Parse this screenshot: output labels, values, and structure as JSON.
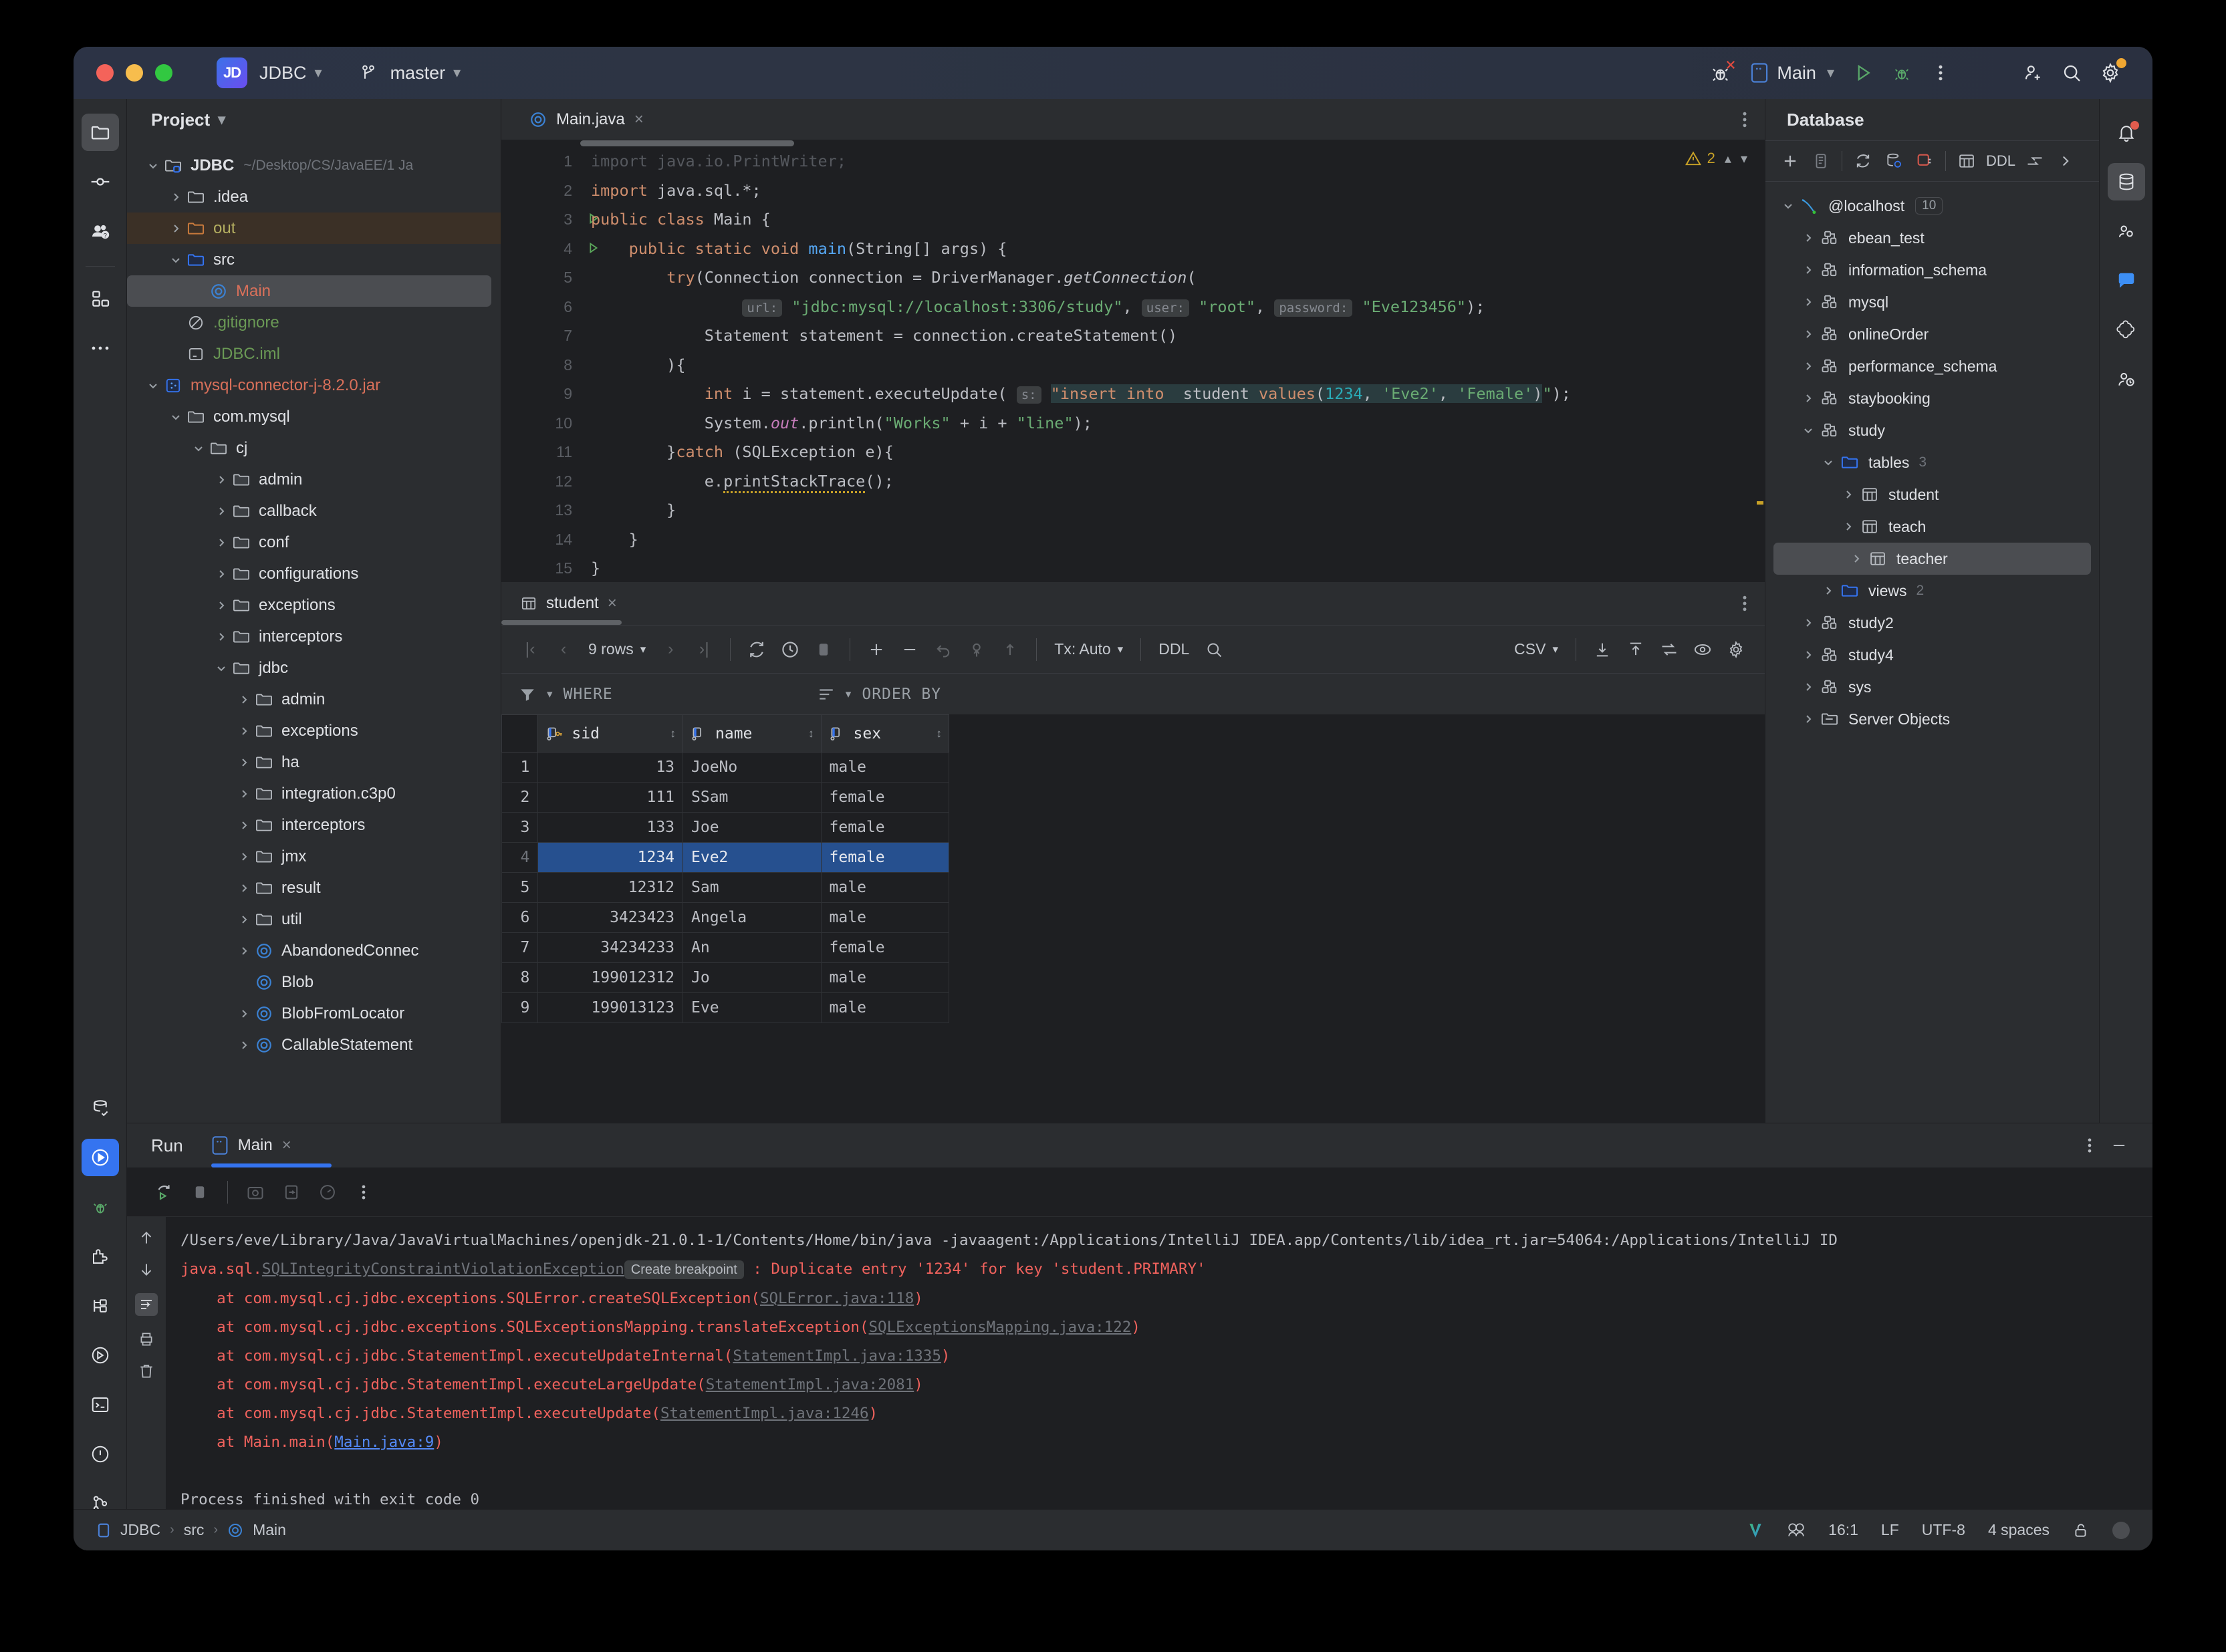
{
  "titlebar": {
    "project_name": "JDBC",
    "project_badge": "JD",
    "branch": "master",
    "run_config": "Main",
    "icons": [
      "debug-disabled-icon",
      "run-config-icon",
      "run-icon",
      "debug-icon",
      "more-options-icon",
      "add-collaborator-icon",
      "search-everywhere-icon",
      "settings-icon"
    ]
  },
  "left_rail": {
    "items": [
      "project-icon",
      "commit-icon",
      "pull-requests-icon",
      "structure-icon",
      "more-tool-windows-icon"
    ],
    "bottom_items": [
      "database-check-icon",
      "run-icon",
      "debug-icon",
      "plugins-icon",
      "structure-icon",
      "services-icon",
      "terminal-icon",
      "problems-icon",
      "version-control-icon"
    ]
  },
  "project_panel": {
    "title": "Project",
    "tree": [
      {
        "label": "JDBC",
        "path": "~/Desktop/CS/JavaEE/1 Ja",
        "indent": 0,
        "arrow": "down",
        "icon": "module-folder-icon",
        "style": "bold"
      },
      {
        "label": ".idea",
        "indent": 1,
        "arrow": "right",
        "icon": "folder-icon",
        "style": "white"
      },
      {
        "label": "out",
        "indent": 1,
        "arrow": "right",
        "icon": "folder-excluded-icon",
        "style": "olive",
        "row": "excluded"
      },
      {
        "label": "src",
        "indent": 1,
        "arrow": "down",
        "icon": "folder-source-icon",
        "style": "white"
      },
      {
        "label": "Main",
        "indent": 2,
        "arrow": "none",
        "icon": "class-icon",
        "style": "red",
        "row": "selected"
      },
      {
        "label": ".gitignore",
        "indent": 1,
        "arrow": "none",
        "icon": "gitignore-icon",
        "style": "green"
      },
      {
        "label": "JDBC.iml",
        "indent": 1,
        "arrow": "none",
        "icon": "iml-icon",
        "style": "green"
      },
      {
        "label": "mysql-connector-j-8.2.0.jar",
        "indent": 0,
        "arrow": "down",
        "icon": "jar-icon",
        "style": "red"
      },
      {
        "label": "com.mysql",
        "indent": 1,
        "arrow": "down",
        "icon": "package-icon",
        "style": "white"
      },
      {
        "label": "cj",
        "indent": 2,
        "arrow": "down",
        "icon": "package-icon",
        "style": "white"
      },
      {
        "label": "admin",
        "indent": 3,
        "arrow": "right",
        "icon": "package-icon",
        "style": "white"
      },
      {
        "label": "callback",
        "indent": 3,
        "arrow": "right",
        "icon": "package-icon",
        "style": "white"
      },
      {
        "label": "conf",
        "indent": 3,
        "arrow": "right",
        "icon": "package-icon",
        "style": "white"
      },
      {
        "label": "configurations",
        "indent": 3,
        "arrow": "right",
        "icon": "package-icon",
        "style": "white"
      },
      {
        "label": "exceptions",
        "indent": 3,
        "arrow": "right",
        "icon": "package-icon",
        "style": "white"
      },
      {
        "label": "interceptors",
        "indent": 3,
        "arrow": "right",
        "icon": "package-icon",
        "style": "white"
      },
      {
        "label": "jdbc",
        "indent": 3,
        "arrow": "down",
        "icon": "package-icon",
        "style": "white"
      },
      {
        "label": "admin",
        "indent": 4,
        "arrow": "right",
        "icon": "package-icon",
        "style": "white"
      },
      {
        "label": "exceptions",
        "indent": 4,
        "arrow": "right",
        "icon": "package-icon",
        "style": "white"
      },
      {
        "label": "ha",
        "indent": 4,
        "arrow": "right",
        "icon": "package-icon",
        "style": "white"
      },
      {
        "label": "integration.c3p0",
        "indent": 4,
        "arrow": "right",
        "icon": "package-icon",
        "style": "white"
      },
      {
        "label": "interceptors",
        "indent": 4,
        "arrow": "right",
        "icon": "package-icon",
        "style": "white"
      },
      {
        "label": "jmx",
        "indent": 4,
        "arrow": "right",
        "icon": "package-icon",
        "style": "white"
      },
      {
        "label": "result",
        "indent": 4,
        "arrow": "right",
        "icon": "package-icon",
        "style": "white"
      },
      {
        "label": "util",
        "indent": 4,
        "arrow": "right",
        "icon": "package-icon",
        "style": "white"
      },
      {
        "label": "AbandonedConnec",
        "indent": 4,
        "arrow": "right",
        "icon": "class-icon",
        "style": "white"
      },
      {
        "label": "Blob",
        "indent": 4,
        "arrow": "none",
        "icon": "class-icon",
        "style": "white"
      },
      {
        "label": "BlobFromLocator",
        "indent": 4,
        "arrow": "right",
        "icon": "class-icon",
        "style": "white"
      },
      {
        "label": "CallableStatement",
        "indent": 4,
        "arrow": "right",
        "icon": "class-icon",
        "style": "white"
      }
    ]
  },
  "editor": {
    "tab": {
      "label": "Main.java",
      "icon": "java-class-icon",
      "close": "×"
    },
    "warnings_count": "2",
    "lines": [
      {
        "n": "1",
        "text": "import java.io.PrintWriter;"
      },
      {
        "n": "2",
        "text": "import java.sql.*;"
      },
      {
        "n": "3",
        "text": "public class Main {",
        "runmark": true
      },
      {
        "n": "4",
        "text": "    public static void main(String[] args) {",
        "runmark": true
      },
      {
        "n": "5",
        "text": "        try(Connection connection = DriverManager.getConnection("
      },
      {
        "n": "6",
        "text": "                url: \"jdbc:mysql://localhost:3306/study\", user: \"root\", password: \"Eve123456\");"
      },
      {
        "n": "7",
        "text": "            Statement statement = connection.createStatement()"
      },
      {
        "n": "8",
        "text": "        ){"
      },
      {
        "n": "9",
        "text": "            int i = statement.executeUpdate( s: \"insert into  student values(1234, 'Eve2', 'Female')\");"
      },
      {
        "n": "10",
        "text": "            System.out.println(\"Works\" + i + \"line\");"
      },
      {
        "n": "11",
        "text": "        }catch (SQLException e){"
      },
      {
        "n": "12",
        "text": "            e.printStackTrace();"
      },
      {
        "n": "13",
        "text": "        }"
      },
      {
        "n": "14",
        "text": "    }"
      },
      {
        "n": "15",
        "text": "}"
      }
    ]
  },
  "grid": {
    "tab_label": "student",
    "tab_icon": "table-icon",
    "tab_close": "×",
    "toolbar": {
      "first_page": "first-page-icon",
      "prev_page": "prev-page-icon",
      "rows_label": "9 rows",
      "next_page": "next-page-icon",
      "last_page": "last-page-icon",
      "reload": "reload-icon",
      "history": "history-icon",
      "stop": "stop-icon",
      "add_row": "add-row-icon",
      "delete_row": "delete-row-icon",
      "revert": "revert-icon",
      "commit": "commit-icon",
      "upload": "upload-icon",
      "tx_label": "Tx: Auto",
      "ddl_label": "DDL",
      "search": "search-icon",
      "csv_label": "CSV",
      "export": "export-icon",
      "import": "import-icon",
      "compare": "compare-icon",
      "view": "view-mode-icon",
      "settings": "settings-icon"
    },
    "where_label": "WHERE",
    "order_by_label": "ORDER BY",
    "columns": [
      {
        "name": "sid",
        "icon": "primary-key-column-icon"
      },
      {
        "name": "name",
        "icon": "column-icon"
      },
      {
        "name": "sex",
        "icon": "column-icon"
      }
    ],
    "rows": [
      {
        "n": "1",
        "sid": "13",
        "name": "JoeNo",
        "sex": "male"
      },
      {
        "n": "2",
        "sid": "111",
        "name": "SSam",
        "sex": "female"
      },
      {
        "n": "3",
        "sid": "133",
        "name": "Joe",
        "sex": "female"
      },
      {
        "n": "4",
        "sid": "1234",
        "name": "Eve2",
        "sex": "female",
        "selected": true
      },
      {
        "n": "5",
        "sid": "12312",
        "name": "Sam",
        "sex": "male"
      },
      {
        "n": "6",
        "sid": "3423423",
        "name": "Angela",
        "sex": "male"
      },
      {
        "n": "7",
        "sid": "34234233",
        "name": "An",
        "sex": "female"
      },
      {
        "n": "8",
        "sid": "199012312",
        "name": "Jo",
        "sex": "male"
      },
      {
        "n": "9",
        "sid": "199013123",
        "name": "Eve",
        "sex": "male"
      }
    ]
  },
  "database_panel": {
    "title": "Database",
    "toolbar": [
      "add-icon",
      "copy-icon",
      "refresh-icon",
      "db-settings-icon",
      "disconnect-icon",
      "table-icon",
      "ddl-label",
      "jump-to-icon",
      "expand-icon"
    ],
    "ddl_label": "DDL",
    "tree": [
      {
        "label": "@localhost",
        "indent": 0,
        "arrow": "down",
        "icon": "mysql-icon",
        "badge": "10"
      },
      {
        "label": "ebean_test",
        "indent": 1,
        "arrow": "right",
        "icon": "schema-icon"
      },
      {
        "label": "information_schema",
        "indent": 1,
        "arrow": "right",
        "icon": "schema-icon"
      },
      {
        "label": "mysql",
        "indent": 1,
        "arrow": "right",
        "icon": "schema-icon"
      },
      {
        "label": "onlineOrder",
        "indent": 1,
        "arrow": "right",
        "icon": "schema-icon"
      },
      {
        "label": "performance_schema",
        "indent": 1,
        "arrow": "right",
        "icon": "schema-icon"
      },
      {
        "label": "staybooking",
        "indent": 1,
        "arrow": "right",
        "icon": "schema-icon"
      },
      {
        "label": "study",
        "indent": 1,
        "arrow": "down",
        "icon": "schema-icon"
      },
      {
        "label": "tables",
        "indent": 2,
        "arrow": "down",
        "icon": "folder-blue-icon",
        "count": "3"
      },
      {
        "label": "student",
        "indent": 3,
        "arrow": "right",
        "icon": "table-icon"
      },
      {
        "label": "teach",
        "indent": 3,
        "arrow": "right",
        "icon": "table-icon"
      },
      {
        "label": "teacher",
        "indent": 3,
        "arrow": "right",
        "icon": "table-icon",
        "selected": true
      },
      {
        "label": "views",
        "indent": 2,
        "arrow": "right",
        "icon": "folder-blue-icon",
        "count": "2"
      },
      {
        "label": "study2",
        "indent": 1,
        "arrow": "right",
        "icon": "schema-icon"
      },
      {
        "label": "study4",
        "indent": 1,
        "arrow": "right",
        "icon": "schema-icon"
      },
      {
        "label": "sys",
        "indent": 1,
        "arrow": "right",
        "icon": "schema-icon"
      },
      {
        "label": "Server Objects",
        "indent": 1,
        "arrow": "right",
        "icon": "server-objects-icon"
      }
    ]
  },
  "right_rail": {
    "items": [
      "notifications-icon",
      "database-icon",
      "ai-assistant-icon",
      "chat-icon",
      "ml-icon",
      "profiler-icon"
    ]
  },
  "run_panel": {
    "title": "Run",
    "tab_label": "Main",
    "tab_icon": "run-config-icon",
    "tab_close": "×",
    "header_icons": [
      "more-options-icon",
      "minimize-icon"
    ],
    "toolbar": [
      "rerun-icon",
      "stop-icon",
      "screenshot-icon",
      "dump-threads-icon",
      "profiler-icon",
      "more-icon"
    ],
    "gutter_icons": [
      "scroll-up-icon",
      "scroll-down-icon",
      "soft-wrap-icon",
      "print-icon",
      "clear-all-icon"
    ],
    "console": [
      {
        "type": "cmdline",
        "text": "/Users/eve/Library/Java/JavaVirtualMachines/openjdk-21.0.1-1/Contents/Home/bin/java -javaagent:/Applications/IntelliJ IDEA.app/Contents/lib/idea_rt.jar=54064:/Applications/IntelliJ ID"
      },
      {
        "type": "exception",
        "prefix": "java.sql.",
        "link": "SQLIntegrityConstraintViolationException",
        "chip": "Create breakpoint",
        "suffix": " : Duplicate entry '1234' for key 'student.PRIMARY'"
      },
      {
        "type": "frame",
        "text": "    at com.mysql.cj.jdbc.exceptions.SQLError.createSQLException(",
        "link": "SQLError.java:118",
        "after": ")"
      },
      {
        "type": "frame",
        "text": "    at com.mysql.cj.jdbc.exceptions.SQLExceptionsMapping.translateException(",
        "link": "SQLExceptionsMapping.java:122",
        "after": ")"
      },
      {
        "type": "frame",
        "text": "    at com.mysql.cj.jdbc.StatementImpl.executeUpdateInternal(",
        "link": "StatementImpl.java:1335",
        "after": ")"
      },
      {
        "type": "frame",
        "text": "    at com.mysql.cj.jdbc.StatementImpl.executeLargeUpdate(",
        "link": "StatementImpl.java:2081",
        "after": ")"
      },
      {
        "type": "frame",
        "text": "    at com.mysql.cj.jdbc.StatementImpl.executeUpdate(",
        "link": "StatementImpl.java:1246",
        "after": ")"
      },
      {
        "type": "frame-main",
        "text": "    at Main.main(",
        "link": "Main.java:9",
        "after": ")"
      },
      {
        "type": "blank",
        "text": ""
      },
      {
        "type": "exit",
        "text": "Process finished with exit code 0"
      }
    ]
  },
  "status_bar": {
    "breadcrumb": [
      "JDBC",
      "src",
      "Main"
    ],
    "caret": "16:1",
    "line_separator": "LF",
    "encoding": "UTF-8",
    "indent": "4 spaces",
    "icons": [
      "vuejs-icon",
      "codewith-icon",
      "lock-icon",
      "status-dot"
    ]
  }
}
